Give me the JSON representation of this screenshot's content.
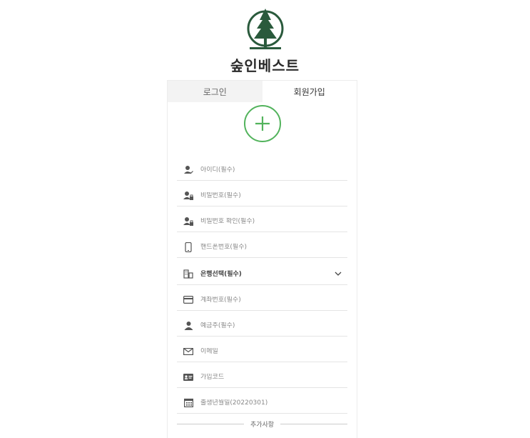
{
  "brand": {
    "name": "숲인베스트"
  },
  "tabs": [
    {
      "label": "로그인"
    },
    {
      "label": "회원가입"
    }
  ],
  "fields": {
    "username": {
      "placeholder": "아이디(필수)",
      "icon": "user-check-icon"
    },
    "password": {
      "placeholder": "비밀번호(필수)",
      "icon": "user-lock-icon"
    },
    "password_confirm": {
      "placeholder": "비밀번호 확인(필수)",
      "icon": "user-lock-icon"
    },
    "phone": {
      "placeholder": "핸드폰번호(필수)",
      "icon": "phone-icon"
    },
    "bank": {
      "label": "은행선택(필수)",
      "icon": "bank-icon"
    },
    "account": {
      "placeholder": "계좌번호(필수)",
      "icon": "card-icon"
    },
    "depositor": {
      "placeholder": "예금주(필수)",
      "icon": "user-icon"
    },
    "email": {
      "placeholder": "이메일",
      "icon": "mail-icon"
    },
    "signup_code": {
      "placeholder": "가입코드",
      "icon": "id-card-icon"
    },
    "birthdate": {
      "placeholder": "출생년월일(20220301)",
      "icon": "calendar-icon"
    }
  },
  "extra_section": {
    "label": "추가사항"
  },
  "colors": {
    "brand_green": "#2a5a3c",
    "accent_green": "#52b35c",
    "icon_gray": "#555555"
  }
}
